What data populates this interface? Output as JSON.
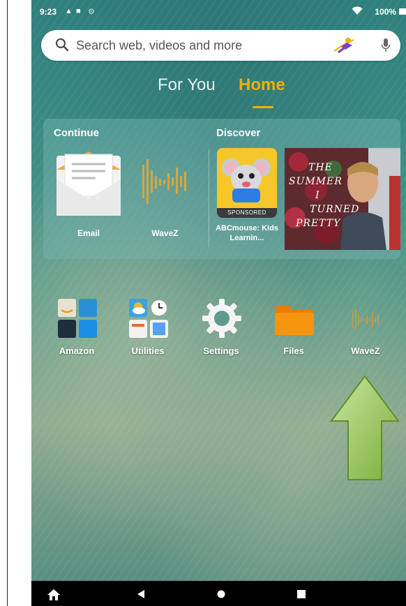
{
  "status_bar": {
    "time": "9:23",
    "battery": "100%"
  },
  "search": {
    "placeholder": "Search web, videos and more"
  },
  "tabs": [
    {
      "label": "For You"
    },
    {
      "label": "Home",
      "active": true
    }
  ],
  "continue_section": {
    "label": "Continue",
    "items": [
      {
        "label": "Email",
        "icon": "email-icon"
      },
      {
        "label": "WaveZ",
        "icon": "wavez-icon"
      }
    ]
  },
  "discover_section": {
    "label": "Discover",
    "items": [
      {
        "label": "ABCmouse: Kids Learnin...",
        "badge": "SPONSORED",
        "icon": "abcmouse-icon"
      },
      {
        "title_lines": [
          "THE",
          "SUMMER",
          "I",
          "TURNED",
          "PRETTY"
        ]
      }
    ]
  },
  "apps": [
    {
      "label": "Amazon",
      "icon": "amazon-folder-icon"
    },
    {
      "label": "Utilities",
      "icon": "utilities-folder-icon"
    },
    {
      "label": "Settings",
      "icon": "gear-icon"
    },
    {
      "label": "Files",
      "icon": "folder-icon"
    },
    {
      "label": "WaveZ",
      "icon": "wavez-icon"
    }
  ],
  "colors": {
    "accent": "#f2b000",
    "annotation_arrow": "#8cbf4a"
  }
}
